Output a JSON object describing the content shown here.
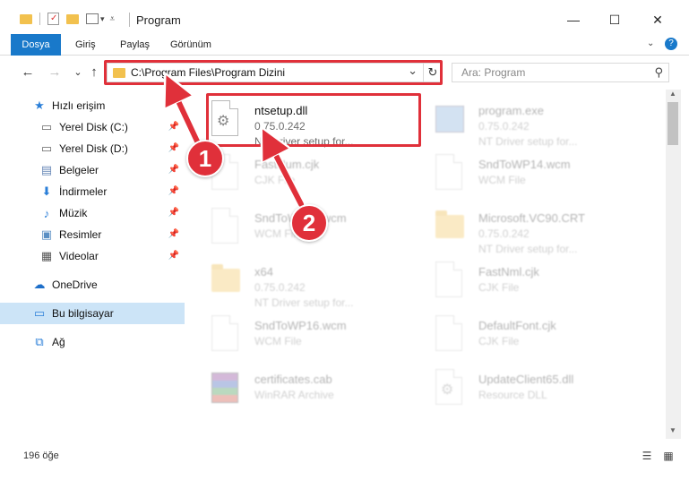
{
  "window": {
    "title": "Program",
    "minimize_glyph": "—",
    "maximize_glyph": "☐",
    "close_glyph": "✕"
  },
  "ribbon": {
    "tabs": [
      {
        "label": "Dosya",
        "active": true
      },
      {
        "label": "Giriş",
        "active": false
      },
      {
        "label": "Paylaş",
        "active": false
      },
      {
        "label": "Görünüm",
        "active": false
      }
    ],
    "accent_color": "#1979ca"
  },
  "nav": {
    "back_glyph": "←",
    "forward_glyph": "→",
    "recent_glyph": "⌄",
    "up_glyph": "↑",
    "address_path": "C:\\Program Files\\Program Dizini",
    "dropdown_glyph": "⌄",
    "refresh_glyph": "↻",
    "search_placeholder": "Ara: Program",
    "search_glyph": "⚲",
    "highlight_color": "#e0303a"
  },
  "sidebar": {
    "items": [
      {
        "label": "Hızlı erişim",
        "icon": "star-icon",
        "glyph": "★",
        "pinned": false,
        "selected": false
      },
      {
        "label": "Yerel Disk (C:)",
        "icon": "drive-icon",
        "glyph": "▭",
        "pinned": true,
        "selected": false
      },
      {
        "label": "Yerel Disk (D:)",
        "icon": "drive-icon",
        "glyph": "▭",
        "pinned": true,
        "selected": false
      },
      {
        "label": "Belgeler",
        "icon": "documents-icon",
        "glyph": "▤",
        "pinned": true,
        "selected": false
      },
      {
        "label": "İndirmeler",
        "icon": "download-icon",
        "glyph": "⬇",
        "pinned": true,
        "selected": false
      },
      {
        "label": "Müzik",
        "icon": "music-icon",
        "glyph": "♪",
        "pinned": true,
        "selected": false
      },
      {
        "label": "Resimler",
        "icon": "pictures-icon",
        "glyph": "▣",
        "pinned": true,
        "selected": false
      },
      {
        "label": "Videolar",
        "icon": "video-icon",
        "glyph": "▦",
        "pinned": true,
        "selected": false
      },
      {
        "label": "OneDrive",
        "icon": "cloud-icon",
        "glyph": "☁",
        "pinned": false,
        "selected": false
      },
      {
        "label": "Bu bilgisayar",
        "icon": "computer-icon",
        "glyph": "▭",
        "pinned": false,
        "selected": true
      },
      {
        "label": "Ağ",
        "icon": "network-icon",
        "glyph": "⧉",
        "pinned": false,
        "selected": false
      }
    ],
    "pin_glyph": "📌"
  },
  "files": [
    {
      "name": "ntsetup.dll",
      "sub1": "0.75.0.242",
      "sub2": "NT Driver setup for...",
      "icon": "dll-file-icon",
      "highlighted": true
    },
    {
      "name": "program.exe",
      "sub1": "0.75.0.242",
      "sub2": "NT Driver setup for...",
      "icon": "exe-file-icon",
      "highlighted": false
    },
    {
      "name": "FastNum.cjk",
      "sub1": "CJK File",
      "sub2": "",
      "icon": "file-icon",
      "highlighted": false
    },
    {
      "name": "SndToWP14.wcm",
      "sub1": "WCM File",
      "sub2": "",
      "icon": "file-icon",
      "highlighted": false
    },
    {
      "name": "SndToWP15.wcm",
      "sub1": "WCM File",
      "sub2": "",
      "icon": "file-icon",
      "highlighted": false
    },
    {
      "name": "Microsoft.VC90.CRT",
      "sub1": "0.75.0.242",
      "sub2": "NT Driver setup for...",
      "icon": "folder-icon",
      "highlighted": false
    },
    {
      "name": "x64",
      "sub1": "0.75.0.242",
      "sub2": "NT Driver setup for...",
      "icon": "folder-icon",
      "highlighted": false
    },
    {
      "name": "FastNml.cjk",
      "sub1": "CJK File",
      "sub2": "",
      "icon": "file-icon",
      "highlighted": false
    },
    {
      "name": "SndToWP16.wcm",
      "sub1": "WCM File",
      "sub2": "",
      "icon": "file-icon",
      "highlighted": false
    },
    {
      "name": "DefaultFont.cjk",
      "sub1": "CJK File",
      "sub2": "",
      "icon": "file-icon",
      "highlighted": false
    },
    {
      "name": "certificates.cab",
      "sub1": "WinRAR Archive",
      "sub2": "",
      "icon": "archive-icon",
      "highlighted": false
    },
    {
      "name": "UpdateClient65.dll",
      "sub1": "Resource DLL",
      "sub2": "",
      "icon": "dll-file-icon",
      "highlighted": false
    }
  ],
  "status": {
    "item_count": "196 öğe",
    "details_view_glyph": "☰",
    "tiles_view_glyph": "▦"
  },
  "annotations": {
    "step1": "1",
    "step2": "2",
    "color": "#e0303a"
  }
}
